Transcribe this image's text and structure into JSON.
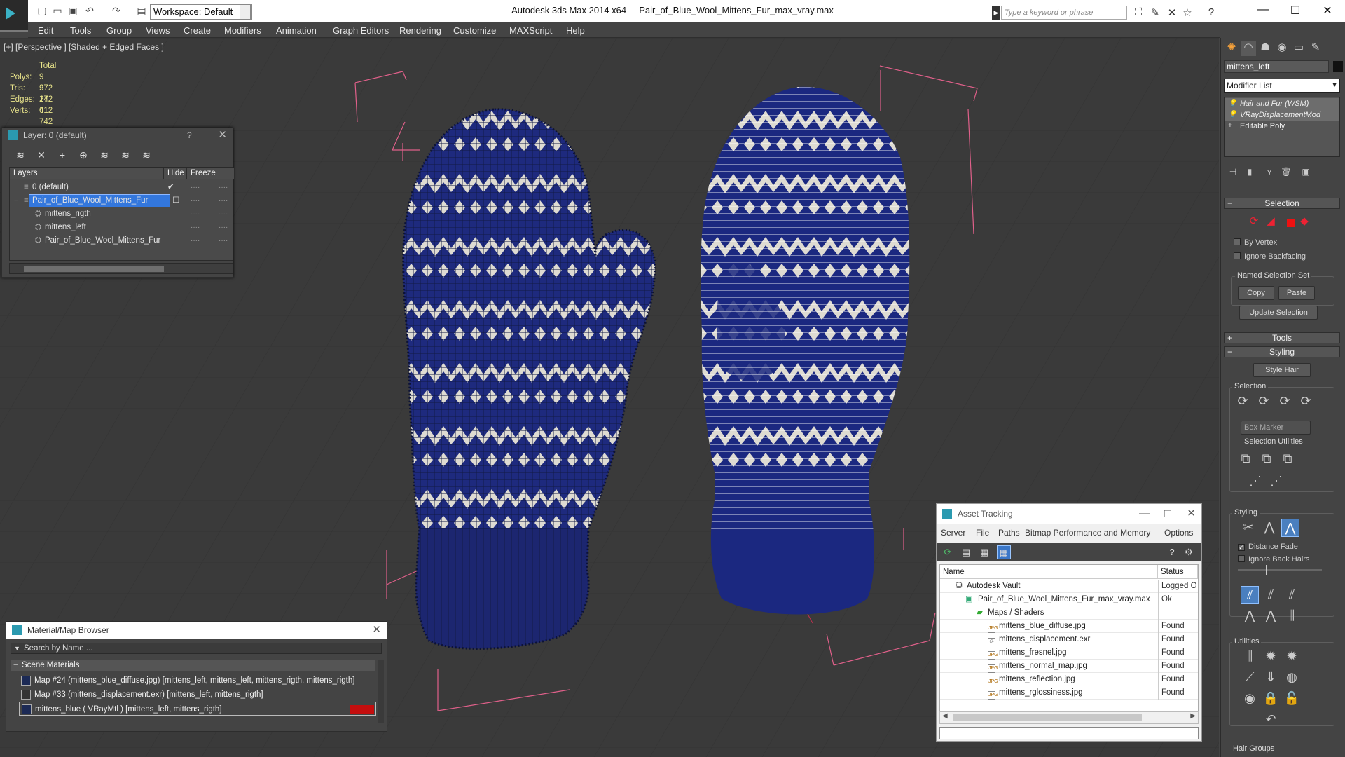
{
  "titlebar": {
    "app": "Autodesk 3ds Max  2014 x64",
    "file": "Pair_of_Blue_Wool_Mittens_Fur_max_vray.max",
    "workspace": "Workspace: Default",
    "search_placeholder": "Type a keyword or phrase"
  },
  "menu": [
    "Edit",
    "Tools",
    "Group",
    "Views",
    "Create",
    "Modifiers",
    "Animation",
    "Graph Editors",
    "Rendering",
    "Customize",
    "MAXScript",
    "Help"
  ],
  "viewport": {
    "label": "[+] [Perspective ] [Shaded + Edged Faces ]",
    "stats": {
      "header": "Total",
      "rows": [
        {
          "k": "Polys:",
          "v": "9 272"
        },
        {
          "k": "Tris:",
          "v": "9 272"
        },
        {
          "k": "Edges:",
          "v": "14 012"
        },
        {
          "k": "Verts:",
          "v": "4 742"
        }
      ]
    }
  },
  "layer_window": {
    "title": "Layer: 0 (default)",
    "help": "?",
    "columns": [
      "Layers",
      "Hide",
      "Freeze"
    ],
    "rows": [
      {
        "name": "0 (default)",
        "check": "✔"
      },
      {
        "name": "Pair_of_Blue_Wool_Mittens_Fur",
        "check": "☐"
      },
      {
        "name": "mittens_rigth",
        "check": ""
      },
      {
        "name": "mittens_left",
        "check": ""
      },
      {
        "name": "Pair_of_Blue_Wool_Mittens_Fur",
        "check": ""
      }
    ]
  },
  "material_browser": {
    "title": "Material/Map Browser",
    "search": "Search by Name ...",
    "category": "Scene Materials",
    "items": [
      "Map #24 (mittens_blue_diffuse.jpg) [mittens_left, mittens_left, mittens_rigth, mittens_rigth]",
      "Map #33 (mittens_displacement.exr) [mittens_left, mittens_rigth]",
      "mittens_blue  ( VRayMtl ) [mittens_left, mittens_rigth]"
    ]
  },
  "asset_tracking": {
    "title": "Asset Tracking",
    "menu": [
      "Server",
      "File",
      "Paths",
      "Bitmap Performance and Memory",
      "Options"
    ],
    "columns": [
      "Name",
      "Status"
    ],
    "rows": [
      {
        "name": "Autodesk Vault",
        "status": "Logged O"
      },
      {
        "name": "Pair_of_Blue_Wool_Mittens_Fur_max_vray.max",
        "status": "Ok"
      },
      {
        "name": "Maps / Shaders",
        "status": ""
      },
      {
        "name": "mittens_blue_diffuse.jpg",
        "status": "Found"
      },
      {
        "name": "mittens_displacement.exr",
        "status": "Found"
      },
      {
        "name": "mittens_fresnel.jpg",
        "status": "Found"
      },
      {
        "name": "mittens_normal_map.jpg",
        "status": "Found"
      },
      {
        "name": "mittens_reflection.jpg",
        "status": "Found"
      },
      {
        "name": "mittens_rglossiness.jpg",
        "status": "Found"
      }
    ]
  },
  "command_panel": {
    "object_name": "mittens_left",
    "modifier_list": "Modifier List",
    "stack": [
      "Hair and Fur (WSM)",
      "VRayDisplacementMod",
      "Editable Poly"
    ],
    "selection_header": "Selection",
    "by_vertex": "By Vertex",
    "ignore_backfacing": "Ignore Backfacing",
    "named_selection_set": "Named Selection Set",
    "copy": "Copy",
    "paste": "Paste",
    "update_selection": "Update Selection",
    "tools_header": "Tools",
    "styling_header": "Styling",
    "style_hair": "Style Hair",
    "selection_group": "Selection",
    "box_marker": "Box Marker",
    "selection_utilities": "Selection Utilities",
    "styling_group": "Styling",
    "distance_fade": "Distance Fade",
    "ignore_back_hairs": "Ignore Back Hairs",
    "utilities_group": "Utilities",
    "hair_groups": "Hair Groups"
  },
  "colors": {
    "wool_blue": "#1c2a7a",
    "wool_white": "#e8e4d6",
    "bbox_pink": "#e0608a",
    "selection_blue": "#3377dd"
  }
}
